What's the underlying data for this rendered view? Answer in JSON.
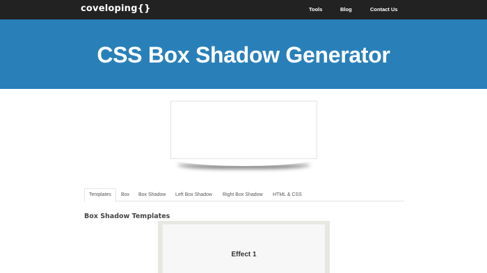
{
  "nav": {
    "brand": "coveloping{}",
    "links": [
      "Tools",
      "Blog",
      "Contact Us"
    ]
  },
  "hero": {
    "title": "CSS Box Shadow Generator"
  },
  "tabs": [
    "Templates",
    "Box",
    "Box Shadow",
    "Left Box Shadow",
    "Right Box Shadow",
    "HTML & CSS"
  ],
  "active_tab": "Templates",
  "section": {
    "title": "Box Shadow Templates"
  },
  "templates": [
    {
      "label": "Effect 1"
    }
  ],
  "colors": {
    "navbar": "#222222",
    "hero": "#2980b9",
    "template_frame": "#e8e8e3"
  }
}
